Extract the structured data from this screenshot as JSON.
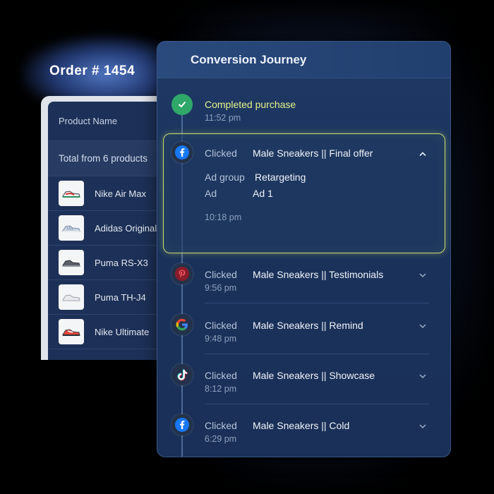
{
  "order": {
    "title": "Order # 1454",
    "column_header": "Product Name",
    "total_label": "Total from 6 products",
    "products": [
      {
        "name": "Nike Air Max",
        "accent": "#d9342b"
      },
      {
        "name": "Adidas Originals",
        "accent": "#a9b8c9"
      },
      {
        "name": "Puma RS-X3",
        "accent": "#4a4f57"
      },
      {
        "name": "Puma TH-J4",
        "accent": "#c8cdd3"
      },
      {
        "name": "Nike Ultimate",
        "accent": "#e2463a"
      }
    ]
  },
  "journey": {
    "title": "Conversion Journey",
    "completed": {
      "label": "Completed purchase",
      "time": "11:52 pm",
      "icon": "check-icon"
    },
    "expanded": {
      "icon": "facebook-icon",
      "action": "Clicked",
      "campaign": "Male Sneakers || Final offer",
      "ad_group_label": "Ad group",
      "ad_group_value": "Retargeting",
      "ad_label": "Ad",
      "ad_value": "Ad 1",
      "time": "10:18 pm"
    },
    "steps": [
      {
        "icon": "pinterest-icon",
        "action": "Clicked",
        "campaign": "Male Sneakers || Testimonials",
        "time": "9:56 pm"
      },
      {
        "icon": "google-icon",
        "action": "Clicked",
        "campaign": "Male Sneakers || Remind",
        "time": "9:48 pm"
      },
      {
        "icon": "tiktok-icon",
        "action": "Clicked",
        "campaign": "Male Sneakers || Showcase",
        "time": "8:12 pm"
      },
      {
        "icon": "facebook-icon",
        "action": "Clicked",
        "campaign": "Male Sneakers || Cold",
        "time": "6:29 pm"
      }
    ]
  },
  "colors": {
    "highlight": "#c9df6a",
    "completed_text": "#e6f28a",
    "success": "#2fa86a"
  }
}
